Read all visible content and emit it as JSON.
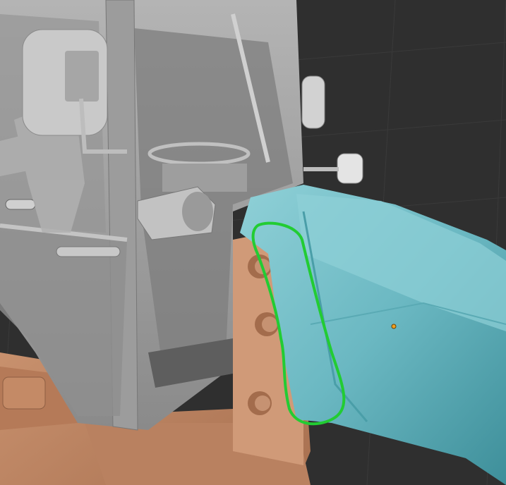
{
  "viewport": {
    "background": "#2f2f2f",
    "grid_color": "#3a3a3a",
    "axis_color": "#4a8a2a"
  },
  "colors": {
    "cab_gray": "#a9a9a9",
    "cab_dark": "#6d6d6d",
    "glass_gray": "#8c8c8c",
    "chassis_tan": "#c7906c",
    "chassis_dark": "#8e5f43",
    "hood_teal": "#6bb8c2",
    "hood_light": "#8fd0d7",
    "hood_dark": "#3e8f9a",
    "annotation_green": "#22cc33",
    "origin_orange": "#f0a020"
  },
  "annotation": {
    "shape": "freehand-loop"
  },
  "objects": [
    "tractor-cab",
    "side-mirror",
    "steering-wheel",
    "driver-figure",
    "chassis-frame",
    "engine-hood",
    "mount-bushing"
  ]
}
